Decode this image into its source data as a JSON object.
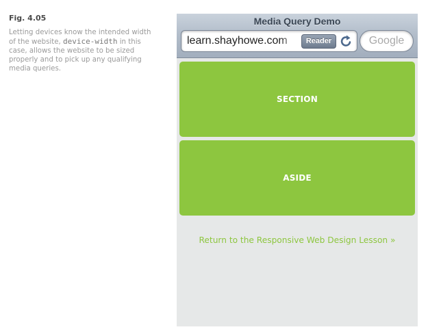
{
  "figure": {
    "label": "Fig. 4.05",
    "text_before": "Letting devices know the intended width of the website,",
    "code": "device-width",
    "text_after": "in this case, allows the website to be sized properly and to pick up any qualifying media queries."
  },
  "browser": {
    "page_title": "Media Query Demo",
    "url": "learn.shayhowe.com",
    "reader_label": "Reader",
    "search_placeholder": "Google"
  },
  "page": {
    "sections": [
      {
        "label": "SECTION"
      },
      {
        "label": "ASIDE"
      }
    ],
    "return_link": "Return to the Responsive Web Design Lesson »"
  },
  "colors": {
    "accent_green": "#8dc63f",
    "page_background": "#e6e8e8",
    "caption_text": "#9a9a9a"
  }
}
